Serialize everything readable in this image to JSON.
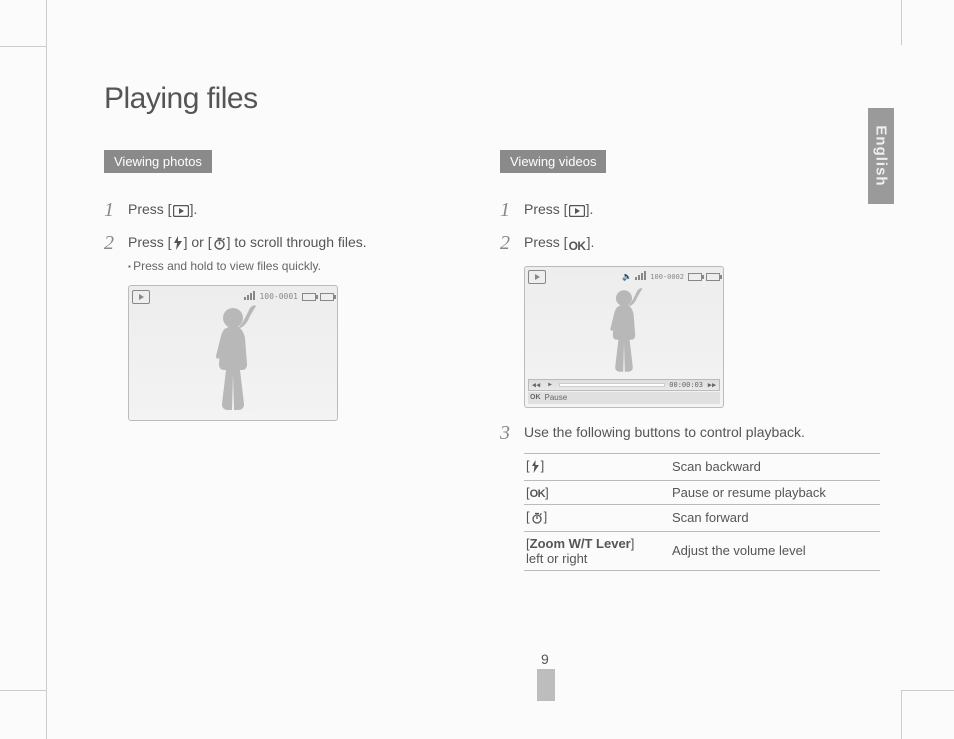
{
  "page": {
    "title": "Playing files",
    "language_tab": "English",
    "page_number": "9"
  },
  "left": {
    "section": "Viewing photos",
    "step1_prefix": "Press [",
    "step1_suffix": "].",
    "step2_prefix": "Press [",
    "step2_mid": "] or [",
    "step2_suffix": "] to scroll through files.",
    "step2_bullet": "Press and hold to view files quickly.",
    "photo_counter": "100-0001"
  },
  "right": {
    "section": "Viewing videos",
    "step1_prefix": "Press [",
    "step1_suffix": "].",
    "step2_prefix": "Press [",
    "step2_suffix": "].",
    "video_counter": "100-0002",
    "video_time": "00:00:03",
    "pause_label": "Pause",
    "step3": "Use the following buttons to control playback.",
    "table": [
      {
        "action": "Scan backward"
      },
      {
        "action": "Pause or resume playback"
      },
      {
        "action": "Scan forward"
      },
      {
        "key_bold": "Zoom W/T Lever",
        "key_plain": "left or right",
        "action": "Adjust the volume level"
      }
    ]
  },
  "icons": {
    "play": "play-icon",
    "flash": "flash-icon",
    "timer": "timer-icon",
    "ok": "OK",
    "rew": "◀◀",
    "fwd": "▶▶",
    "play_small": "▶"
  }
}
